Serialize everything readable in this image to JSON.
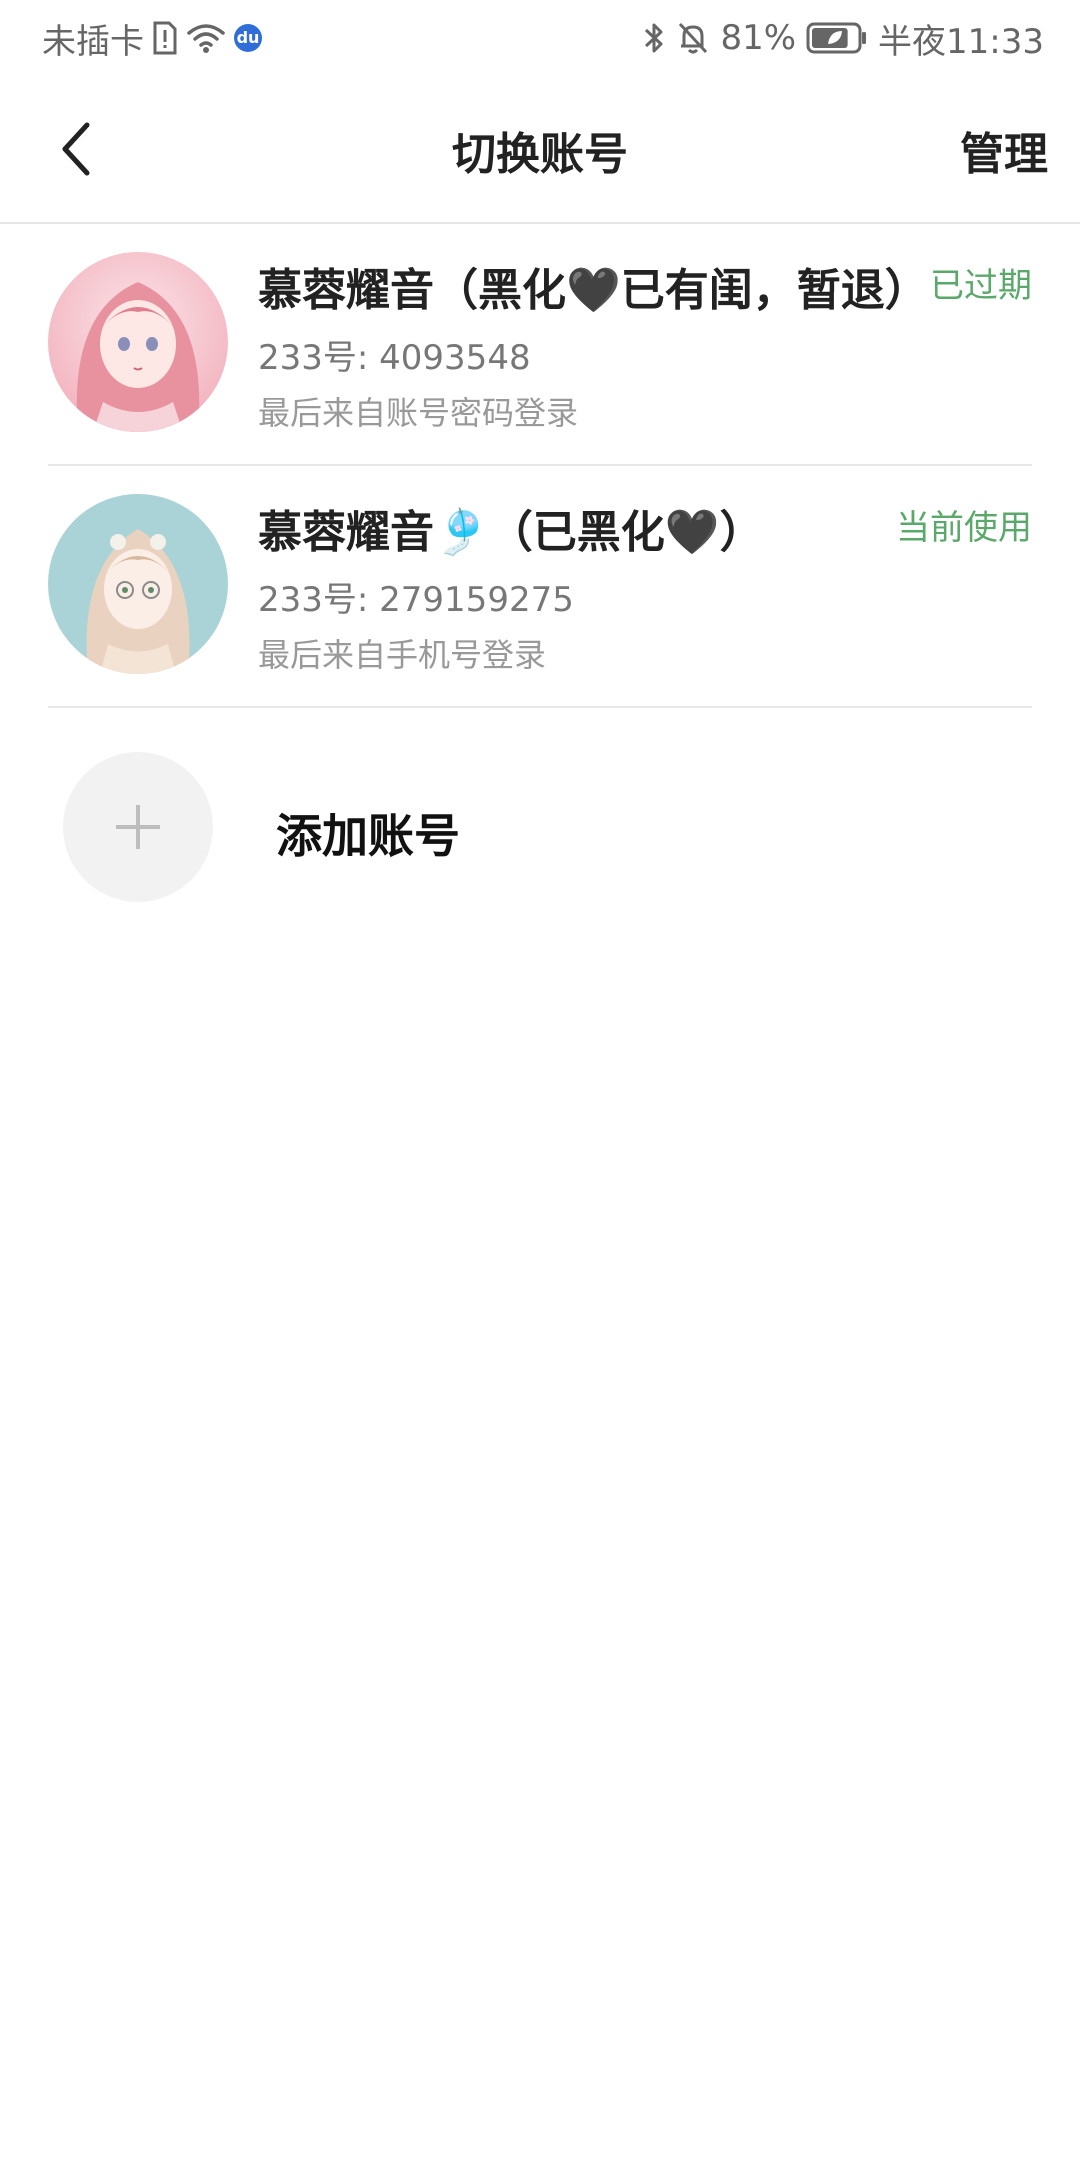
{
  "status_bar": {
    "carrier": "未插卡",
    "sim_icon": "sim-alert-icon",
    "wifi_icon": "wifi-icon",
    "app_badge": "du",
    "bluetooth_icon": "bluetooth-icon",
    "mute_icon": "bell-off-icon",
    "battery_percent": "81%",
    "battery_level": 0.81,
    "time": "半夜11:33"
  },
  "nav": {
    "back_icon": "chevron-left-icon",
    "title": "切换账号",
    "manage_label": "管理"
  },
  "accounts": [
    {
      "name": "慕蓉耀音（黑化🖤已有闺，暂退）",
      "status": "已过期",
      "id": "233号: 4093548",
      "login": "最后来自账号密码登录",
      "avatar_colors": [
        "#f7c6cf",
        "#e8929f",
        "#fbe5e8"
      ]
    },
    {
      "name": "慕蓉耀音🎐（已黑化🖤）",
      "status": "当前使用",
      "id": "233号: 279159275",
      "login": "最后来自手机号登录",
      "avatar_colors": [
        "#a9d3d6",
        "#e9d3c0",
        "#c9a98a"
      ]
    }
  ],
  "add_account": {
    "label": "添加账号",
    "icon": "plus-icon"
  },
  "colors": {
    "accent_green": "#5aa86a",
    "divider": "#e8e8e8",
    "add_circle_bg": "#f2f2f2"
  }
}
